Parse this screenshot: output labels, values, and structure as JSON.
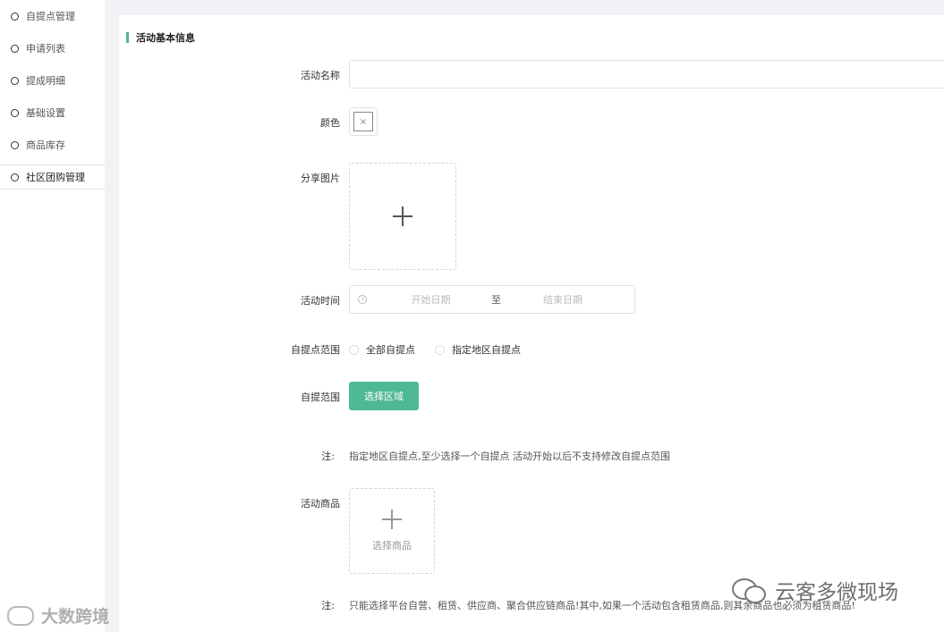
{
  "sidebar": {
    "items": [
      {
        "label": "自提点管理"
      },
      {
        "label": "申请列表"
      },
      {
        "label": "提成明细"
      },
      {
        "label": "基础设置"
      },
      {
        "label": "商品库存"
      },
      {
        "label": "社区团购管理"
      }
    ],
    "active_index": 5
  },
  "section": {
    "title": "活动基本信息"
  },
  "form": {
    "name_label": "活动名称",
    "name_value": "",
    "color_label": "颜色",
    "color_close_glyph": "×",
    "share_image_label": "分享图片",
    "time_label": "活动时间",
    "start_placeholder": "开始日期",
    "range_separator": "至",
    "end_placeholder": "结束日期",
    "pickup_scope_label": "自提点范围",
    "pickup_options": [
      "全部自提点",
      "指定地区自提点"
    ],
    "region_label": "自提范围",
    "region_button": "选择区域",
    "note_label": "注:",
    "note1": "指定地区自提点,至少选择一个自提点 活动开始以后不支持修改自提点范围",
    "goods_label": "活动商品",
    "goods_button": "选择商品",
    "note2": "只能选择平台自营、租赁、供应商、聚合供应链商品!其中,如果一个活动包含租赁商品,则其余商品也必须为租赁商品!"
  },
  "watermarks": {
    "left": "大数跨境",
    "right": "云客多微现场"
  },
  "colors": {
    "accent": "#4fb895",
    "page_bg": "#f0f2f5"
  }
}
